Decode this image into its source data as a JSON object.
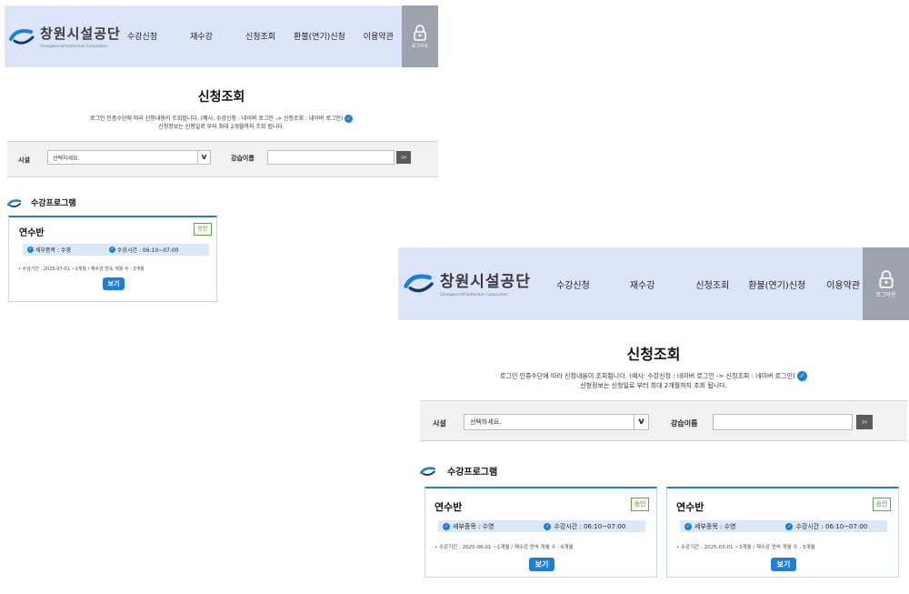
{
  "header": {
    "logo_text": "창원시설공단",
    "logo_sub": "Changwon Infrastructure Corporation",
    "nav": [
      "수강신청",
      "재수강",
      "신청조회",
      "환불(연기)신청",
      "이용약관"
    ],
    "logout_label": "로그아웃"
  },
  "page_title": "신청조회",
  "notice": {
    "line1": "로그인 인증수단에 따라 신청내용이 조회됩니다. (예시: 수강신청 : 네이버 로그인 -> 신청조회 : 네이버 로그인)",
    "line2": "신청정보는 신청일로 부터 최대 2개월까지 조회 됩니다."
  },
  "search": {
    "facility_label": "시설",
    "facility_value": "선택하세요.",
    "class_label": "강습이름",
    "class_value": "",
    "search_button": "검색"
  },
  "section_title": "수강프로그램",
  "cards_small": [
    {
      "title": "연수반",
      "badge": "승인",
      "detail": "세부종목 : 수영",
      "time": "수강시간 : 06:10~07:00",
      "period": "• 수강기간 : 2025-07-01 ~1개월 / 재수강 연속 개월 수 : 3개월",
      "view_button": "보기"
    }
  ],
  "cards_large": [
    {
      "title": "연수반",
      "badge": "승인",
      "detail": "세부종목 : 수영",
      "time": "수강시간 : 06:10~07:00",
      "period": "• 수강기간 : 2025-06-01 ~1개월 / 재수강 연속 개월 수 : 6개월",
      "view_button": "보기"
    },
    {
      "title": "연수반",
      "badge": "승인",
      "detail": "세부종목 : 수영",
      "time": "수강시간 : 06:10~07:00",
      "period": "• 수강기간 : 2025-03-01 ~3개월 / 재수강 연속 개월 수 : 5개월",
      "view_button": "보기"
    }
  ],
  "colors": {
    "header_bg": "#dde5fb",
    "accent_blue": "#1e7fd8",
    "approved_green": "#4a9a2a",
    "logout_bg": "#9da3ad"
  },
  "icons": {
    "logo": "swoosh-logo-icon",
    "logout": "lock-icon",
    "check": "check-circle-icon",
    "dropdown": "chevron-down-icon"
  }
}
